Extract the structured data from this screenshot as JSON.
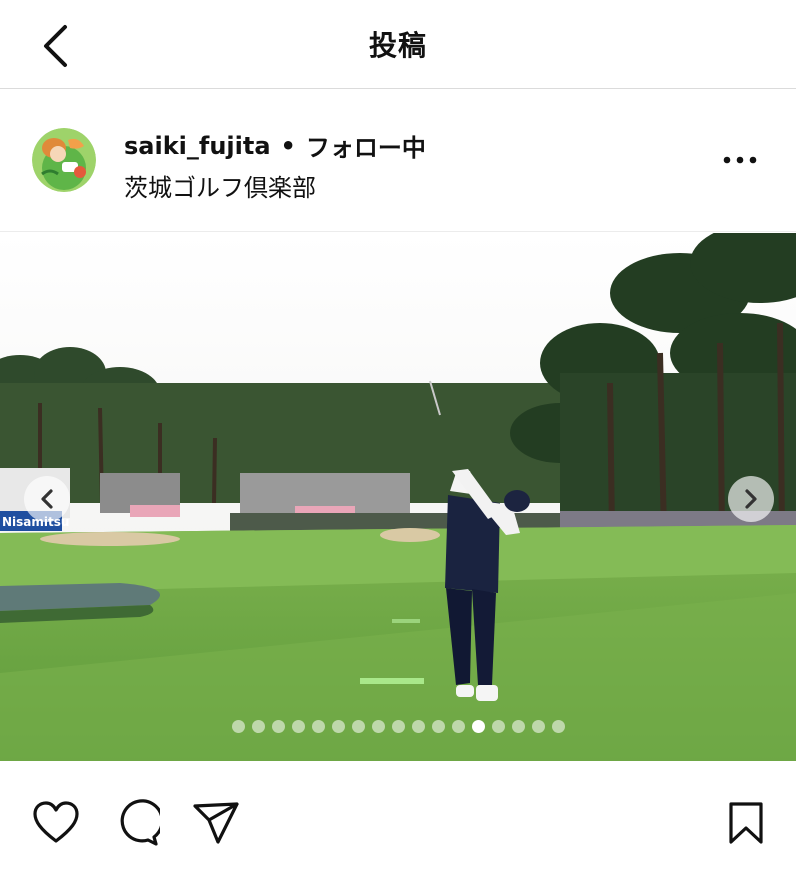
{
  "header": {
    "title": "投稿",
    "back_icon": "chevron-left-icon"
  },
  "post": {
    "username": "saiki_fujita",
    "separator": "•",
    "follow_state": "フォロー中",
    "location": "茨城ゴルフ倶楽部",
    "more_icon": "more-horizontal-icon",
    "banner_text": "Nisamitsu",
    "carousel": {
      "total_images": 17,
      "current_index": 13
    }
  },
  "actions": {
    "like_icon": "heart-icon",
    "comment_icon": "comment-icon",
    "share_icon": "send-icon",
    "save_icon": "bookmark-icon"
  },
  "colors": {
    "border": "#dbdbdb",
    "text": "#111111",
    "fairway": "#6fa845",
    "sky": "#f2f2f2"
  }
}
